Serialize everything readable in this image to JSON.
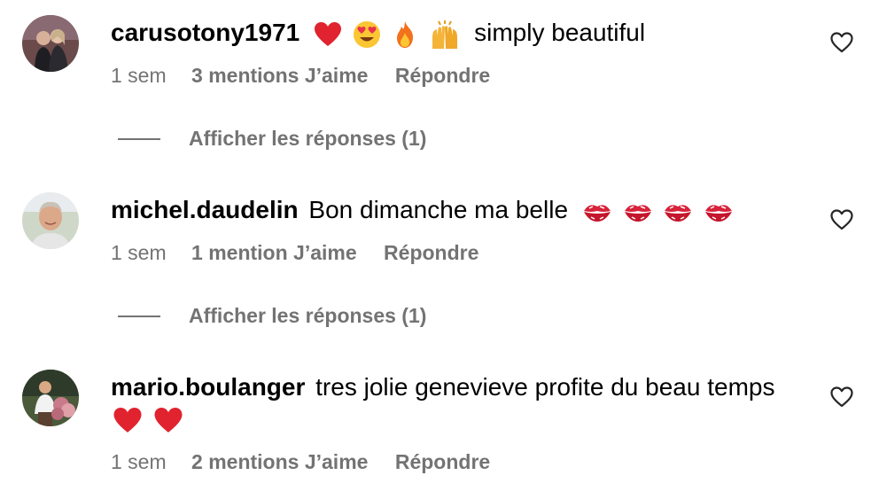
{
  "comments": [
    {
      "username": "carusotony1971",
      "text": "simply beautiful",
      "emojis": [
        "red-heart",
        "heart-eyes",
        "fire",
        "raised-hands"
      ],
      "time": "1 sem",
      "likes": "3 mentions J’aime",
      "reply": "Répondre",
      "view_replies": "Afficher les réponses (1)"
    },
    {
      "username": "michel.daudelin",
      "text": "Bon dimanche ma belle",
      "emojis": [
        "kiss-mark",
        "kiss-mark",
        "kiss-mark",
        "kiss-mark"
      ],
      "time": "1 sem",
      "likes": "1 mention J’aime",
      "reply": "Répondre",
      "view_replies": "Afficher les réponses (1)"
    },
    {
      "username": "mario.boulanger",
      "text": "tres jolie genevieve profite du beau temps",
      "emojis": [
        "red-heart",
        "red-heart"
      ],
      "time": "1 sem",
      "likes": "2 mentions J’aime",
      "reply": "Répondre"
    }
  ],
  "icons": {
    "like": "heart-outline-icon"
  },
  "colors": {
    "secondary_text": "#737373",
    "heart_red": "#e0232e"
  }
}
